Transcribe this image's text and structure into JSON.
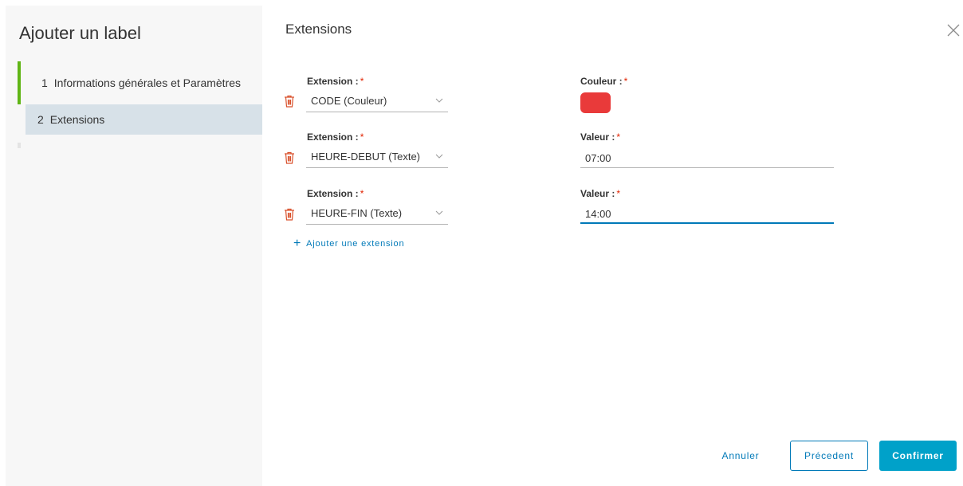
{
  "modal": {
    "title": "Ajouter un label"
  },
  "steps": [
    {
      "num": "1",
      "label": "Informations générales et Paramètres"
    },
    {
      "num": "2",
      "label": "Extensions"
    }
  ],
  "content": {
    "title": "Extensions",
    "rows": [
      {
        "ext_label": "Extension :",
        "ext_value": "CODE (Couleur)",
        "val_label": "Couleur :",
        "type": "color",
        "color": "#e93a3a"
      },
      {
        "ext_label": "Extension :",
        "ext_value": "HEURE-DEBUT (Texte)",
        "val_label": "Valeur :",
        "type": "text",
        "value": "07:00"
      },
      {
        "ext_label": "Extension :",
        "ext_value": "HEURE-FIN (Texte)",
        "val_label": "Valeur :",
        "type": "text",
        "value": "14:00"
      }
    ],
    "required_mark": "*",
    "add_extension": "Ajouter une extension"
  },
  "footer": {
    "cancel": "Annuler",
    "previous": "Précedent",
    "confirm": "Confirmer"
  },
  "colors": {
    "accent": "#0079b8",
    "primary": "#00a1c9",
    "done": "#60b515",
    "danger": "#e12200"
  }
}
